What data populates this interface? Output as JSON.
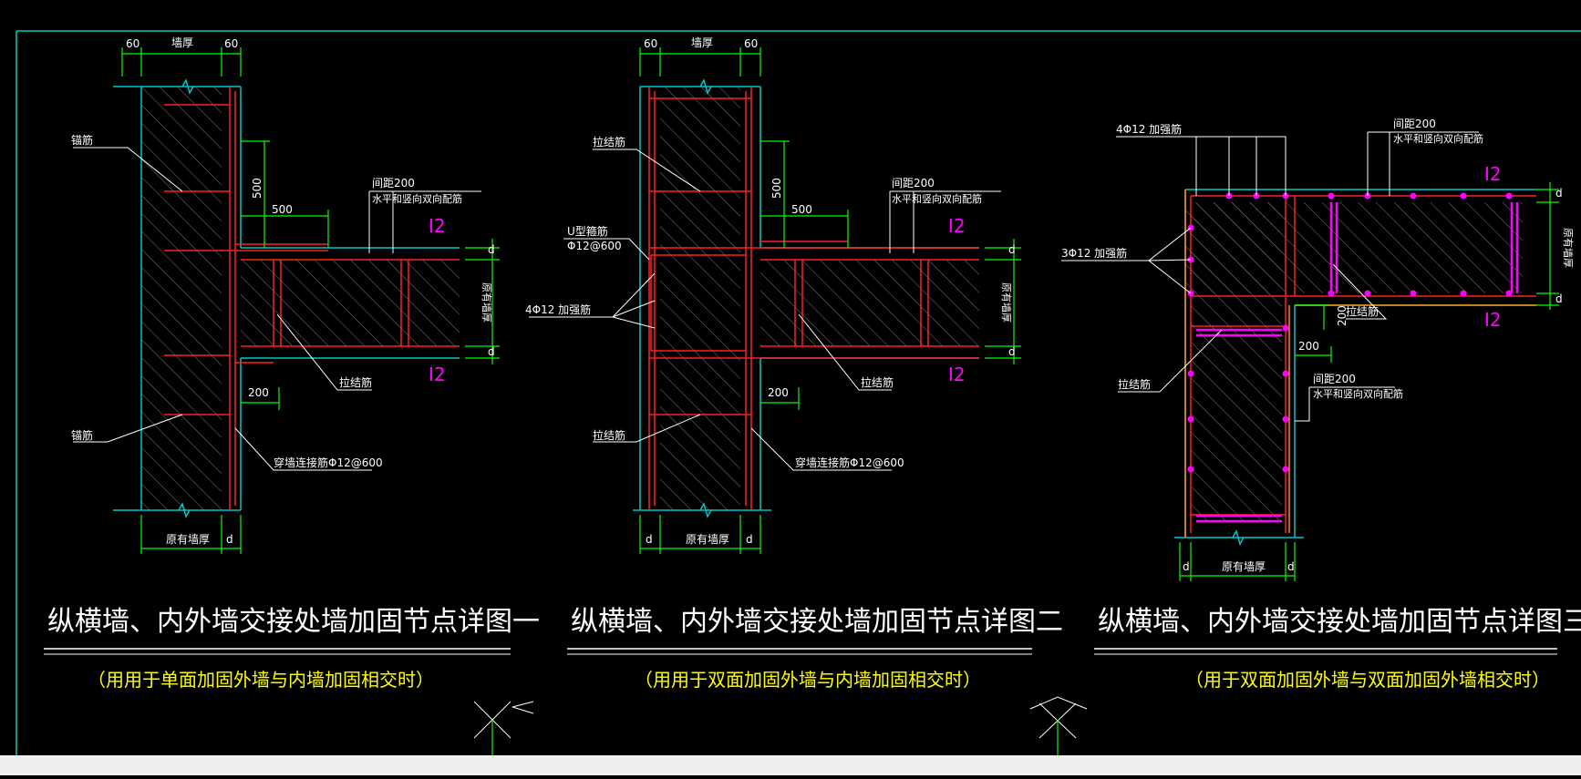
{
  "colors": {
    "background": "#000000",
    "frame": "#00c8c8",
    "dimension": "#00ff00",
    "rebar": "#ff2020",
    "wall": "#00c8c8",
    "text": "#ffffff",
    "subtitle": "#ffff00",
    "magenta": "#ff00ff",
    "hatch": "#7a7a7a",
    "steel_angle": "#ff8c00"
  },
  "detail1": {
    "title": "纵横墙、内外墙交接处墙加固节点详图一",
    "subtitle": "（用用于单面加固外墙与内墙加固相交时）",
    "dim_top": [
      "60",
      "墙厚",
      "60"
    ],
    "dim_bottom": [
      "原有墙厚",
      "d"
    ],
    "dim_500_v": "500",
    "dim_500_h": "500",
    "dim_200": "200",
    "d_marks": [
      "d",
      "d"
    ],
    "section_mark_1": "I2",
    "section_mark_2": "I2",
    "wall_label_right": "原有墙厚",
    "label_anchor_top": "锚筋",
    "label_anchor_bottom": "锚筋",
    "label_spacing": "间距200",
    "label_distribution": "水平和竖向双向配筋",
    "label_tie": "拉结筋",
    "label_through": "穿墙连接筋Φ12@600"
  },
  "detail2": {
    "title": "纵横墙、内外墙交接处墙加固节点详图二",
    "subtitle": "（用用于双面加固外墙与内墙加固相交时）",
    "dim_top": [
      "60",
      "墙厚",
      "60"
    ],
    "dim_bottom": [
      "d",
      "原有墙厚",
      "d"
    ],
    "dim_500_v": "500",
    "dim_500_h": "500",
    "dim_200": "200",
    "d_marks": [
      "d",
      "d"
    ],
    "section_mark_1": "I2",
    "section_mark_2": "I2",
    "wall_label_right": "原有墙厚",
    "label_tie_top": "拉结筋",
    "label_u_bar": "U型箍筋",
    "label_u_bar_spec": "Φ12@600",
    "label_add_bar": "4Φ12 加强筋",
    "label_tie_bottom": "拉结筋",
    "label_spacing": "间距200",
    "label_distribution": "水平和竖向双向配筋",
    "label_tie_right": "拉结筋",
    "label_through": "穿墙连接筋Φ12@600"
  },
  "detail3": {
    "title": "纵横墙、内外墙交接处墙加固节点详图三",
    "subtitle": "（用于双面加固外墙与双面加固外墙相交时）",
    "label_add_top": "4Φ12 加强筋",
    "label_add_left": "3Φ12 加强筋",
    "label_spacing_top": "间距200",
    "label_distribution_top": "水平和竖向双向配筋",
    "label_tie_right": "拉结筋",
    "label_tie_left": "拉结筋",
    "label_spacing_mid": "间距200",
    "label_distribution_mid": "水平和竖向双向配筋",
    "dim_200_v": "200",
    "dim_200_h": "200",
    "section_mark_1": "I2",
    "section_mark_2": "I2",
    "d_marks": [
      "d",
      "d"
    ],
    "wall_label_right": "原有墙厚",
    "dim_bottom": [
      "d",
      "原有墙厚",
      "d"
    ]
  }
}
